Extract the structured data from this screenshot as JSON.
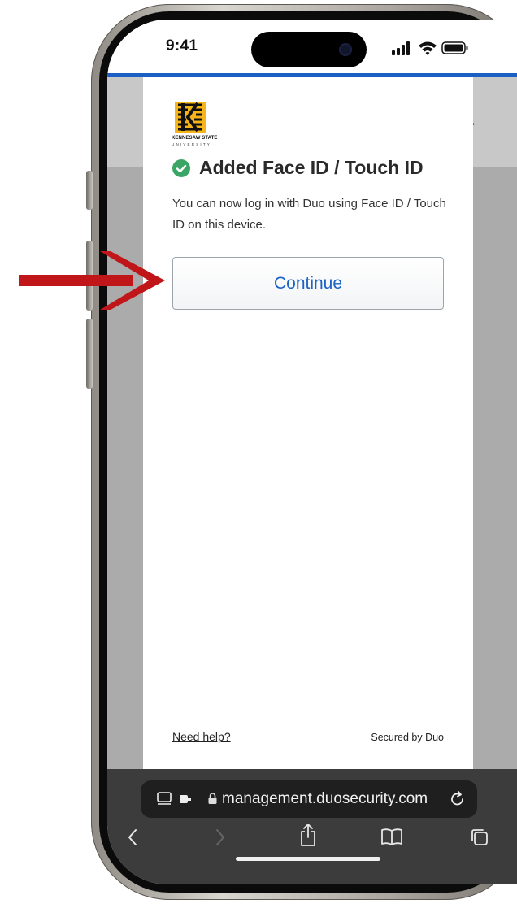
{
  "status_bar": {
    "time": "9:41"
  },
  "university": {
    "name": "KENNESAW STATE",
    "subname": "UNIVERSITY"
  },
  "dialog": {
    "title": "Added Face ID / Touch ID",
    "description": "You can now log in with Duo using Face ID / Touch ID on this device.",
    "continue_label": "Continue",
    "help_link": "Need help?",
    "secured_text": "Secured by Duo"
  },
  "background": {
    "arrow_text": "→"
  },
  "browser": {
    "url": "management.duosecurity.com"
  },
  "colors": {
    "accent_blue": "#1b63c5",
    "success_green": "#3aa564",
    "annotation_red": "#c0161a"
  },
  "icons": [
    "signal-icon",
    "wifi-icon",
    "battery-icon",
    "check-circle-icon",
    "reader-icon",
    "extension-icon",
    "lock-icon",
    "reload-icon",
    "back-icon",
    "forward-icon",
    "share-icon",
    "bookmarks-icon",
    "tabs-icon",
    "red-arrow-annotation"
  ]
}
